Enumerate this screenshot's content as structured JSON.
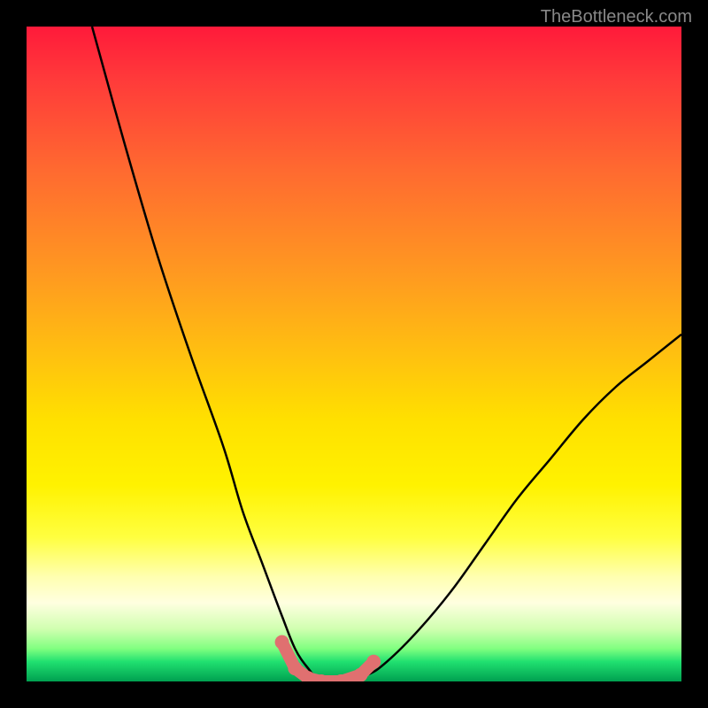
{
  "watermark": "TheBottleneck.com",
  "chart_data": {
    "type": "line",
    "title": "",
    "xlabel": "",
    "ylabel": "",
    "xlim": [
      0,
      100
    ],
    "ylim": [
      0,
      100
    ],
    "series": [
      {
        "name": "bottleneck-curve",
        "x": [
          10,
          15,
          20,
          25,
          30,
          33,
          36,
          39,
          41,
          43,
          45,
          48,
          52,
          55,
          60,
          65,
          70,
          75,
          80,
          85,
          90,
          95,
          100
        ],
        "y": [
          100,
          82,
          65,
          50,
          36,
          26,
          18,
          10,
          5,
          2,
          0,
          0,
          1,
          3,
          8,
          14,
          21,
          28,
          34,
          40,
          45,
          49,
          53
        ]
      },
      {
        "name": "highlight-segment",
        "x": [
          39,
          41,
          43,
          45,
          48,
          51,
          53
        ],
        "y": [
          6,
          2,
          0.5,
          0,
          0,
          1,
          3
        ]
      }
    ],
    "gradient_stops": [
      {
        "pos": 0,
        "color": "#ff1a3a"
      },
      {
        "pos": 0.5,
        "color": "#ffc010"
      },
      {
        "pos": 0.78,
        "color": "#ffff40"
      },
      {
        "pos": 0.95,
        "color": "#80ff80"
      },
      {
        "pos": 1.0,
        "color": "#00a050"
      }
    ]
  }
}
